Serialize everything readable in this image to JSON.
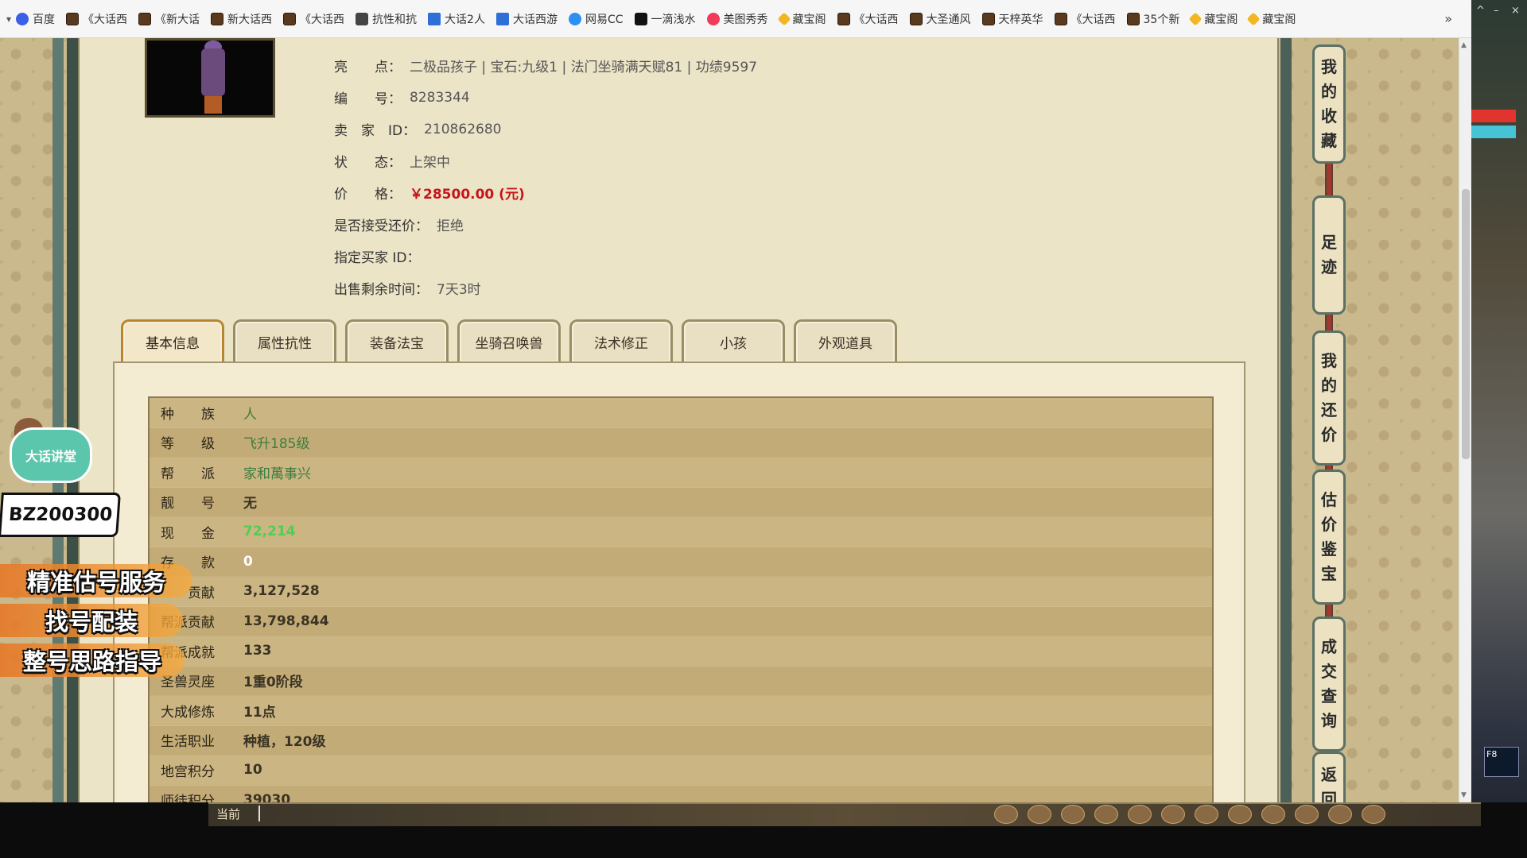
{
  "bookmarks": [
    {
      "label": "百度",
      "icon": "baidu"
    },
    {
      "label": "《大话西",
      "icon": "game"
    },
    {
      "label": "《新大话",
      "icon": "game"
    },
    {
      "label": "新大话西",
      "icon": "game"
    },
    {
      "label": "《大话西",
      "icon": "game"
    },
    {
      "label": "抗性和抗",
      "icon": "dk"
    },
    {
      "label": "大话2人",
      "icon": "dh"
    },
    {
      "label": "大话西游",
      "icon": "dh"
    },
    {
      "label": "网易CC",
      "icon": "cc"
    },
    {
      "label": "一滴浅水",
      "icon": "tt"
    },
    {
      "label": "美图秀秀",
      "icon": "mt"
    },
    {
      "label": "藏宝阁",
      "icon": "cbg"
    },
    {
      "label": "《大话西",
      "icon": "game"
    },
    {
      "label": "大圣通风",
      "icon": "game"
    },
    {
      "label": "天梓英华",
      "icon": "game"
    },
    {
      "label": "《大话西",
      "icon": "game"
    },
    {
      "label": "35个新",
      "icon": "game"
    },
    {
      "label": "藏宝阁",
      "icon": "cbg"
    },
    {
      "label": "藏宝阁",
      "icon": "cbg"
    }
  ],
  "listing": {
    "highlights_key": "亮　　点：",
    "highlights_value": "二极品孩子 | 宝石:九级1 | 法门坐骑满天赋81 | 功绩9597",
    "id_key": "编　　号：",
    "id_value": "8283344",
    "seller_key": "卖　家　ID：",
    "seller_value": "210862680",
    "status_key": "状　　态：",
    "status_value": "上架中",
    "price_key": "价　　格：",
    "price_value": "￥28500.00 (元)",
    "counter_key": "是否接受还价：",
    "counter_value": "拒绝",
    "buyer_key": "指定买家 ID：",
    "buyer_value": "",
    "remain_key": "出售剩余时间：",
    "remain_value": "7天3时"
  },
  "tabs": [
    "基本信息",
    "属性抗性",
    "装备法宝",
    "坐骑召唤兽",
    "法术修正",
    "小孩",
    "外观道具"
  ],
  "basic_info": [
    {
      "label": "种　　族",
      "value": "人",
      "style": "green"
    },
    {
      "label": "等　　级",
      "value": "飞升185级",
      "style": "green"
    },
    {
      "label": "帮　　派",
      "value": "家和萬事兴",
      "style": "green"
    },
    {
      "label": "靓　　号",
      "value": "无",
      "style": "dark"
    },
    {
      "label": "现　　金",
      "value": "72,214",
      "style": "bright"
    },
    {
      "label": "存　　款",
      "value": "0",
      "style": "white"
    },
    {
      "label": "　　贡献",
      "value": "3,127,528",
      "style": "dark"
    },
    {
      "label": "帮派贡献",
      "value": "13,798,844",
      "style": "dark"
    },
    {
      "label": "帮派成就",
      "value": "133",
      "style": "dark"
    },
    {
      "label": "圣兽灵座",
      "value": "1重0阶段",
      "style": "dark"
    },
    {
      "label": "大成修炼",
      "value": "11点",
      "style": "dark"
    },
    {
      "label": "生活职业",
      "value": "种植，120级",
      "style": "dark"
    },
    {
      "label": "地宫积分",
      "value": "10",
      "style": "dark"
    },
    {
      "label": "师徒积分",
      "value": "39030",
      "style": "dark"
    }
  ],
  "side_nav": [
    {
      "label": "我的收藏",
      "chars": [
        "我",
        "的",
        "收",
        "藏"
      ]
    },
    {
      "label": "足迹",
      "chars": [
        "足",
        "迹"
      ]
    },
    {
      "label": "我的还价",
      "chars": [
        "我",
        "的",
        "还",
        "价"
      ]
    },
    {
      "label": "估价鉴宝",
      "chars": [
        "估",
        "价",
        "鉴",
        "宝"
      ]
    },
    {
      "label": "成交查询",
      "chars": [
        "成",
        "交",
        "查",
        "询"
      ]
    },
    {
      "label": "返回",
      "chars": [
        "返",
        "回"
      ]
    }
  ],
  "ads": {
    "mascot": "大话讲堂",
    "badge": "BZ200300",
    "line1": "精准估号服务",
    "line2": "找号配装",
    "line3": "整号思路指导"
  },
  "game_bar": {
    "label": "当前",
    "f8": "F8"
  },
  "bookmark_more": "»"
}
